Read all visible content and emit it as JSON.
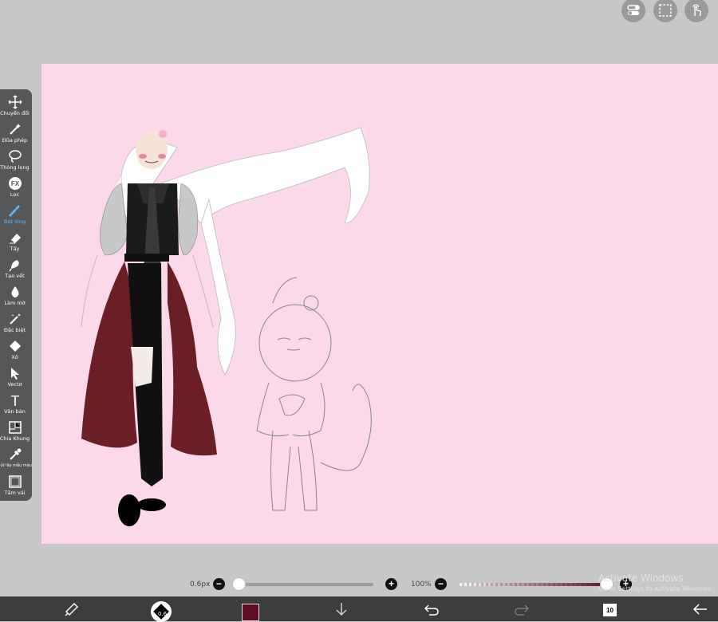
{
  "top_buttons": [
    {
      "name": "toggle-icon"
    },
    {
      "name": "selection-icon"
    },
    {
      "name": "touch-icon"
    }
  ],
  "toolbar": {
    "items": [
      {
        "label": "Chuyển đổi",
        "icon": "move-icon"
      },
      {
        "label": "Đũa phép",
        "icon": "magic-wand-icon"
      },
      {
        "label": "Thòng lọng",
        "icon": "lasso-icon"
      },
      {
        "label": "Lọc",
        "icon": "fx-filter-icon",
        "glyph": "FX"
      },
      {
        "label": "Bút lông",
        "icon": "brush-icon",
        "active": true
      },
      {
        "label": "Tẩy",
        "icon": "eraser-icon"
      },
      {
        "label": "Tạo vết",
        "icon": "smudge-icon"
      },
      {
        "label": "Làm mờ",
        "icon": "blur-icon"
      },
      {
        "label": "Đặc biệt",
        "icon": "special-icon"
      },
      {
        "label": "Xô",
        "icon": "bucket-icon"
      },
      {
        "label": "Vectơ",
        "icon": "vector-icon"
      },
      {
        "label": "Văn bản",
        "icon": "text-icon",
        "glyph": "T"
      },
      {
        "label": "Chia Khung",
        "icon": "frame-divider-icon"
      },
      {
        "label": "Bút lấy mẫu màu",
        "icon": "eyedropper-icon"
      },
      {
        "label": "Tấm vải",
        "icon": "canvas-icon"
      }
    ],
    "active_color": "#5fb7ff"
  },
  "sliders": {
    "size_label": "0.6px",
    "size_fraction": 0.0,
    "opacity_label": "100%",
    "opacity_fraction": 1.0,
    "minus": "−",
    "plus": "+"
  },
  "watermark": {
    "line1": "Activate Windows",
    "line2": "Go to Settings to activate Windows."
  },
  "bottom_bar": {
    "brush_size_badge": "0.6",
    "current_color": "#5e0d24",
    "layer_count": "10",
    "icons": [
      "transform-icon",
      "brush-size-icon",
      "color-icon",
      "download-icon",
      "undo-icon",
      "redo-icon",
      "layers-icon",
      "back-icon"
    ]
  },
  "canvas": {
    "background": "#fbd9ea"
  }
}
